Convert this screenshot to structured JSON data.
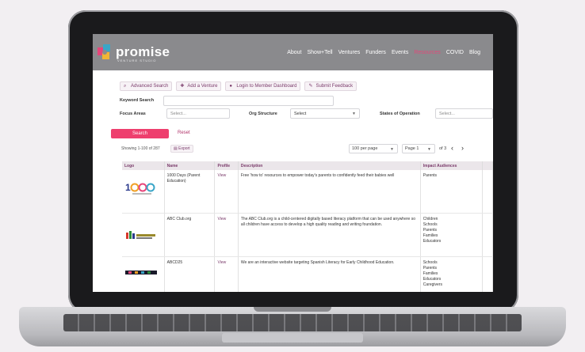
{
  "site": {
    "logo_text": "promise",
    "logo_sub": "VENTURE STUDIO",
    "nav": [
      "About",
      "Show+Tell",
      "Ventures",
      "Funders",
      "Events",
      "Resources",
      "COVID",
      "Blog"
    ],
    "active_nav": "Resources",
    "accent_color": "#ee3f6e",
    "brand_purple": "#7a3a6a"
  },
  "toolbar": {
    "advanced_search": "Advanced Search",
    "add_venture": "Add a Venture",
    "login": "Login to Member Dashboard",
    "feedback": "Submit Feedback"
  },
  "filters": {
    "keyword_label": "Keyword Search",
    "focus_label": "Focus Areas",
    "focus_placeholder": "Select...",
    "org_label": "Org Structure",
    "org_value": "Select",
    "states_label": "States of Operation",
    "states_placeholder": "Select...",
    "search_button": "Search",
    "reset_link": "Reset"
  },
  "results": {
    "showing": "Showing 1-100 of 287",
    "export": "Export",
    "per_page": "100 per page",
    "page": "Page 1",
    "of": "of 3"
  },
  "table": {
    "columns": [
      "Logo",
      "Name",
      "Profile",
      "Description",
      "Impact Audiences"
    ],
    "rows": [
      {
        "logo": "1000 Days",
        "name": "1000 Days (Parent Education)",
        "profile": "View",
        "description": "Free 'how to' resources to empower today's parents to confidently feed their babies well",
        "audiences": [
          "Parents"
        ]
      },
      {
        "logo": "ABC Club",
        "name": "ABC Club.org",
        "profile": "View",
        "description": "The ABC Club.org is a child-centered digitally based literacy platform that can be used anywhere so all children have access to develop a high quality reading and writing foundation.",
        "audiences": [
          "Children",
          "Schools",
          "Parents",
          "Families",
          "Educators"
        ]
      },
      {
        "logo": "ABCD25",
        "name": "ABCD25",
        "profile": "View",
        "description": "We are an interactive website targeting Spanish Literacy for Early Childhood Education.",
        "audiences": [
          "Schools",
          "Parents",
          "Families",
          "Educators",
          "Caregivers"
        ]
      }
    ]
  }
}
